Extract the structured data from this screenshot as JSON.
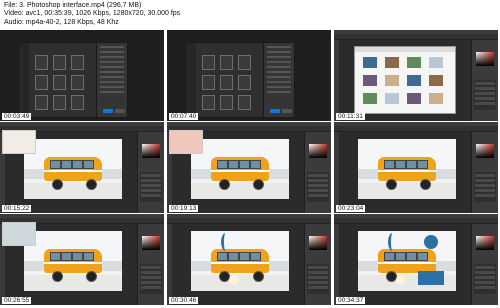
{
  "header": {
    "file": "File: 3. Photoshop interface.mp4 (296.7 MB)",
    "video": "Video: avc1, 00:35:39, 1026 Kbps, 1280x720, 30.000 fps",
    "audio": "Audio: mp4a-40-2, 128 Kbps, 48 Khz"
  },
  "thumbnails": [
    {
      "timestamp": "00:03:49",
      "kind": "new-document-dialog"
    },
    {
      "timestamp": "00:07:40",
      "kind": "new-document-dialog"
    },
    {
      "timestamp": "00:11:31",
      "kind": "file-browser"
    },
    {
      "timestamp": "00:15:22",
      "kind": "van-with-thumbnail",
      "overlay_color": "#f1ede6"
    },
    {
      "timestamp": "00:19:13",
      "kind": "van-with-thumbnail",
      "overlay_color": "#f0c7bd"
    },
    {
      "timestamp": "00:23:04",
      "kind": "van"
    },
    {
      "timestamp": "00:26:55",
      "kind": "van-with-thumbnail",
      "overlay_color": "#cfd9dd"
    },
    {
      "timestamp": "00:30:46",
      "kind": "van-with-shapes"
    },
    {
      "timestamp": "00:34:37",
      "kind": "van-with-shapes-large"
    }
  ],
  "colors": {
    "van": "#f0a21a",
    "app_bg": "#2b2b2b",
    "shape_blue": "#2e6fa6"
  }
}
